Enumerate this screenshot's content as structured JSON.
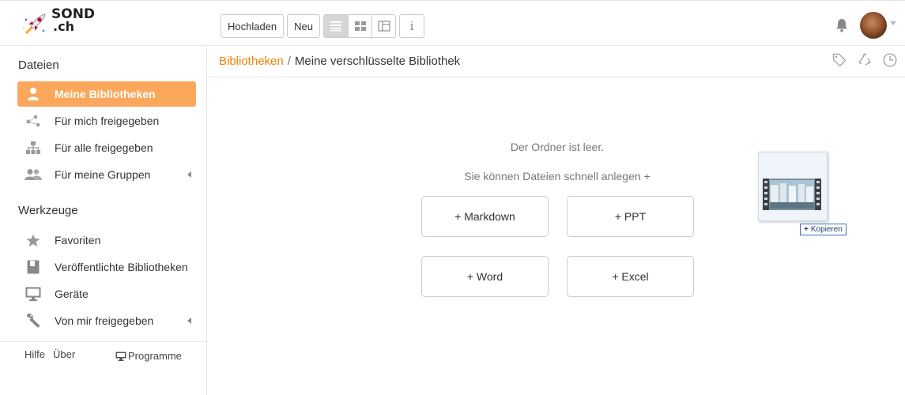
{
  "brand": {
    "line1": "SOND",
    "line2": ".ch"
  },
  "toolbar": {
    "upload_label": "Hochladen",
    "new_label": "Neu",
    "info_label": "i"
  },
  "sidebar": {
    "files_heading": "Dateien",
    "files_items": [
      {
        "label": "Meine Bibliotheken",
        "icon": "user-icon",
        "active": true
      },
      {
        "label": "Für mich freigegeben",
        "icon": "share-icon"
      },
      {
        "label": "Für alle freigegeben",
        "icon": "org-chart-icon"
      },
      {
        "label": "Für meine Gruppen",
        "icon": "group-icon",
        "has_caret": true
      }
    ],
    "tools_heading": "Werkzeuge",
    "tools_items": [
      {
        "label": "Favoriten",
        "icon": "star-icon"
      },
      {
        "label": "Veröffentlichte Bibliotheken",
        "icon": "book-icon"
      },
      {
        "label": "Geräte",
        "icon": "monitor-icon"
      },
      {
        "label": "Von mir freigegeben",
        "icon": "wrench-icon",
        "has_caret": true
      }
    ],
    "footer": {
      "help": "Hilfe",
      "about": "Über",
      "programs": "Programme"
    }
  },
  "breadcrumb": {
    "parent": "Bibliotheken",
    "separator": "/",
    "current": "Meine verschlüsselte Bibliothek"
  },
  "empty_state": {
    "title": "Der Ordner ist leer.",
    "subtitle": "Sie können Dateien schnell anlegen +",
    "buttons": {
      "markdown": "+ Markdown",
      "ppt": "+ PPT",
      "word": "+ Word",
      "excel": "+ Excel"
    }
  },
  "drag": {
    "copy_label": "Kopieren",
    "plus": "+"
  },
  "colors": {
    "accent": "#fba75c",
    "link": "#eb8205",
    "border": "#e6e6e6"
  }
}
